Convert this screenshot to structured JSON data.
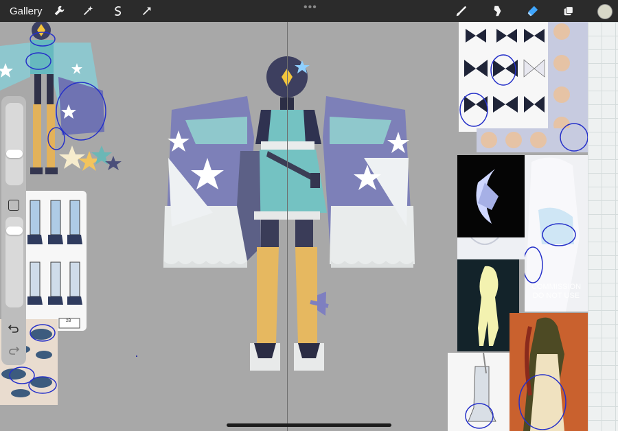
{
  "app": {
    "gallery_label": "Gallery",
    "accent_color": "#3fa6ff",
    "toolbar_bg": "#2b2b2b",
    "canvas_bg": "#a8a8a8"
  },
  "toolbar": {
    "left_tools": [
      "wrench-icon",
      "magic-wand-icon",
      "selection-icon",
      "transform-arrow-icon"
    ],
    "right_tools": [
      "brush-icon",
      "smudge-icon",
      "eraser-icon",
      "layers-icon"
    ],
    "active_tool": "eraser-icon",
    "current_color": "#d8d8c8"
  },
  "reference": {
    "watermark_line1": "COMMISSION",
    "watermark_line2": "DO NOT USE",
    "tag_label": "2B"
  }
}
